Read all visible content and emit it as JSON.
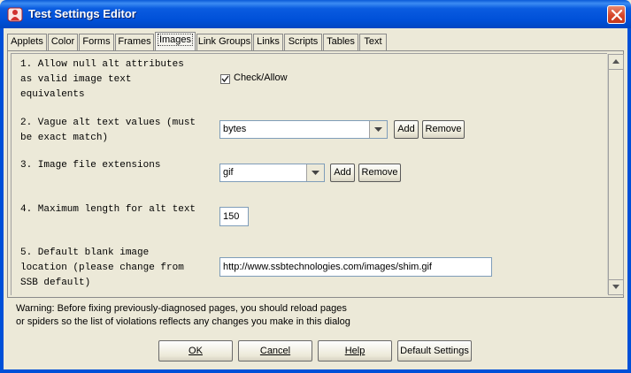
{
  "window": {
    "title": "Test Settings Editor",
    "icon": "app-figure-icon",
    "close_icon": "close-icon"
  },
  "tabs": [
    {
      "label": "Applets"
    },
    {
      "label": "Color"
    },
    {
      "label": "Forms"
    },
    {
      "label": "Frames"
    },
    {
      "label": "Images",
      "active": true
    },
    {
      "label": "Link Groups"
    },
    {
      "label": "Links"
    },
    {
      "label": "Scripts"
    },
    {
      "label": "Tables"
    },
    {
      "label": "Text"
    }
  ],
  "settings": {
    "s1": {
      "label": "1. Allow null alt attributes\nas valid image text\nequivalents",
      "checkbox_label": "Check/Allow",
      "checked": true
    },
    "s2": {
      "label": "2. Vague alt text values (must\nbe exact match)",
      "value": "bytes",
      "add": "Add",
      "remove": "Remove"
    },
    "s3": {
      "label": "3. Image file extensions",
      "value": "gif",
      "add": "Add",
      "remove": "Remove"
    },
    "s4": {
      "label": "4. Maximum length for alt text",
      "value": "150"
    },
    "s5": {
      "label": "5. Default blank image\nlocation (please change from\nSSB default)",
      "value": "http://www.ssbtechnologies.com/images/shim.gif"
    }
  },
  "warning": "Warning: Before fixing previously-diagnosed pages, you should reload pages\nor spiders so the list of violations reflects any changes you make in this dialog",
  "buttons": {
    "ok": "OK",
    "cancel": "Cancel",
    "help": "Help",
    "defaults": "Default Settings"
  }
}
